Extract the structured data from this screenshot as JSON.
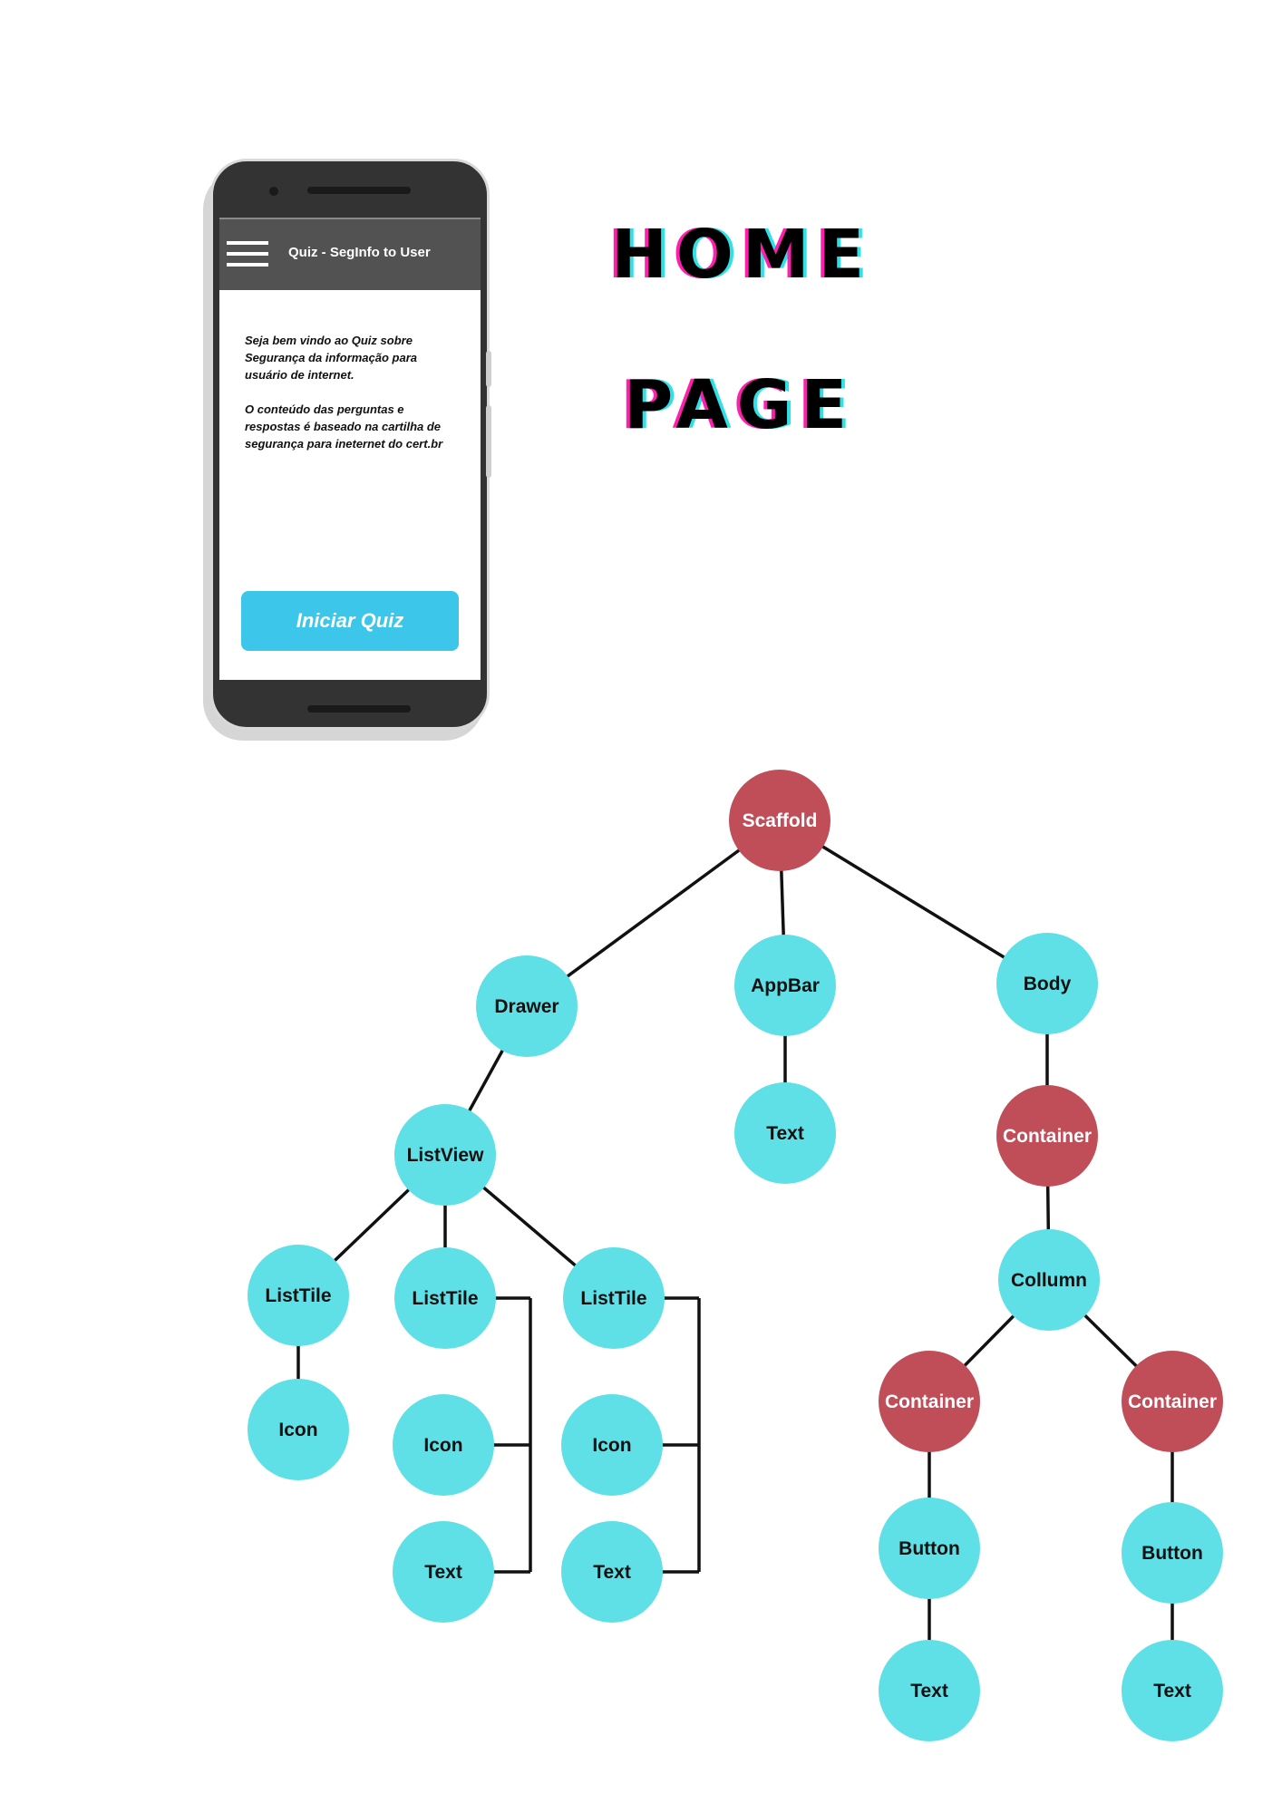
{
  "page_title": {
    "line1": "HOME",
    "line2": "PAGE"
  },
  "phone": {
    "app_bar_title": "Quiz - SegInfo to User",
    "menu_icon": "hamburger-menu-icon",
    "welcome_paragraphs": [
      "Seja bem vindo ao Quiz sobre Segurança da informação para usuário de internet.",
      "O conteúdo das perguntas e respostas é baseado na cartilha de segurança para ineternet do cert.br"
    ],
    "start_button_label": "Iniciar Quiz",
    "start_button_color": "#3cc6ea"
  },
  "tree": {
    "colors": {
      "widget": "#5fe0e6",
      "layout": "#c04e58",
      "edge": "#111111"
    },
    "nodes": [
      {
        "id": "scaffold",
        "label": "Scaffold",
        "kind": "layout"
      },
      {
        "id": "drawer",
        "label": "Drawer",
        "kind": "widget"
      },
      {
        "id": "appbar",
        "label": "AppBar",
        "kind": "widget"
      },
      {
        "id": "body",
        "label": "Body",
        "kind": "widget"
      },
      {
        "id": "appbar-text",
        "label": "Text",
        "kind": "widget"
      },
      {
        "id": "container1",
        "label": "Container",
        "kind": "layout"
      },
      {
        "id": "listview",
        "label": "ListView",
        "kind": "widget"
      },
      {
        "id": "collumn",
        "label": "Collumn",
        "kind": "widget"
      },
      {
        "id": "listtile1",
        "label": "ListTile",
        "kind": "widget"
      },
      {
        "id": "listtile2",
        "label": "ListTile",
        "kind": "widget"
      },
      {
        "id": "listtile3",
        "label": "ListTile",
        "kind": "widget"
      },
      {
        "id": "icon1",
        "label": "Icon",
        "kind": "widget"
      },
      {
        "id": "icon2",
        "label": "Icon",
        "kind": "widget"
      },
      {
        "id": "text2",
        "label": "Text",
        "kind": "widget"
      },
      {
        "id": "icon3",
        "label": "Icon",
        "kind": "widget"
      },
      {
        "id": "text3",
        "label": "Text",
        "kind": "widget"
      },
      {
        "id": "container2",
        "label": "Container",
        "kind": "layout"
      },
      {
        "id": "container3",
        "label": "Container",
        "kind": "layout"
      },
      {
        "id": "button1",
        "label": "Button",
        "kind": "widget"
      },
      {
        "id": "button2",
        "label": "Button",
        "kind": "widget"
      },
      {
        "id": "button1-text",
        "label": "Text",
        "kind": "widget"
      },
      {
        "id": "button2-text",
        "label": "Text",
        "kind": "widget"
      }
    ],
    "edges": [
      [
        "scaffold",
        "drawer"
      ],
      [
        "scaffold",
        "appbar"
      ],
      [
        "scaffold",
        "body"
      ],
      [
        "appbar",
        "appbar-text"
      ],
      [
        "body",
        "container1"
      ],
      [
        "container1",
        "collumn"
      ],
      [
        "drawer",
        "listview"
      ],
      [
        "listview",
        "listtile1"
      ],
      [
        "listview",
        "listtile2"
      ],
      [
        "listview",
        "listtile3"
      ],
      [
        "listtile1",
        "icon1"
      ],
      [
        "collumn",
        "container2"
      ],
      [
        "collumn",
        "container3"
      ],
      [
        "container2",
        "button1"
      ],
      [
        "button1",
        "button1-text"
      ],
      [
        "container3",
        "button2"
      ],
      [
        "button2",
        "button2-text"
      ]
    ],
    "bracket_groups": [
      {
        "parent": "listtile2",
        "children": [
          "icon2",
          "text2"
        ]
      },
      {
        "parent": "listtile3",
        "children": [
          "icon3",
          "text3"
        ]
      }
    ]
  }
}
